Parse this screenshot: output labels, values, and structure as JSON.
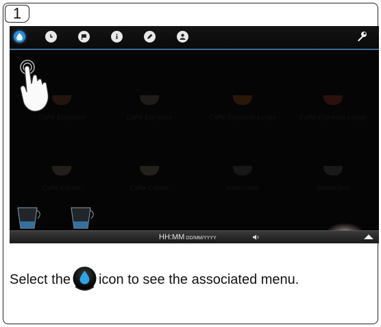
{
  "step": {
    "number": "1"
  },
  "screen": {
    "toolbar": {
      "icons": [
        {
          "name": "water-drop-icon",
          "active": true
        },
        {
          "name": "clock-icon",
          "active": false
        },
        {
          "name": "flag-icon",
          "active": false
        },
        {
          "name": "info-icon",
          "active": false
        },
        {
          "name": "pencil-icon",
          "active": false
        },
        {
          "name": "user-icon",
          "active": false
        }
      ],
      "right_icon": "wrench-icon",
      "accent_color": "#2b8fd6"
    },
    "beverages": [
      {
        "label": "Caffè Espresso"
      },
      {
        "label": "Caffè Espresso"
      },
      {
        "label": "Caffè Espresso Lungo"
      },
      {
        "label": "Caffè Espresso Lungo"
      },
      {
        "label": "Caffè Crème"
      },
      {
        "label": "Caffè Crème"
      },
      {
        "label": "Americano"
      },
      {
        "label": "Americano"
      }
    ],
    "status": {
      "time": "HH:MM",
      "date": "DD/MM/YYYY"
    }
  },
  "caption": {
    "before_icon": "Select the",
    "after_icon": "icon to see the associated menu."
  }
}
